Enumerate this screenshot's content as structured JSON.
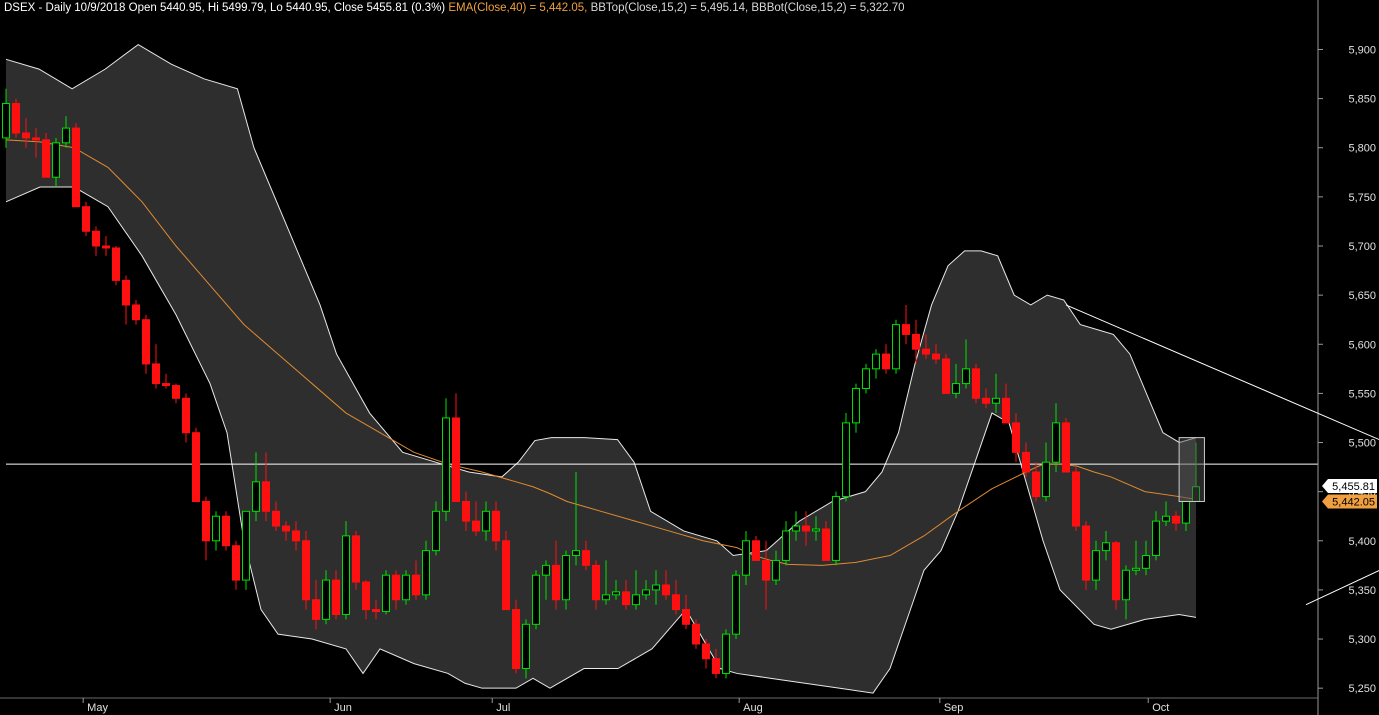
{
  "header": {
    "symbol_line": "DSEX - Daily 10/9/2018 Open 5440.95, Hi 5499.79, Lo 5440.95, Close 5455.81 (0.3%)",
    "ema_label": "EMA(Close,40) = 5,442.05,",
    "bb_label": "BBTop(Close,15,2) = 5,495.14, BBBot(Close,15,2) = 5,322.70"
  },
  "badges": {
    "close": "5,455.81",
    "ema": "5,442.05"
  },
  "colors": {
    "background": "#000000",
    "band_fill": "#2e2e2e",
    "band_line": "#e8e8e8",
    "bull": "#00e000",
    "bear": "#ff1010",
    "ema": "#e08a30",
    "trendline": "#ffffff",
    "close_badge": "#ffffff",
    "ema_badge": "#f0a040"
  },
  "chart_data": {
    "type": "candlestick",
    "title": "DSEX - Daily",
    "ylim": [
      5240,
      5930
    ],
    "y_ticks": [
      5250,
      5300,
      5350,
      5400,
      5450,
      5500,
      5550,
      5600,
      5650,
      5700,
      5750,
      5800,
      5850,
      5900
    ],
    "y_tick_labels": [
      "5,250",
      "5,300",
      "5,350",
      "5,400",
      "5,450",
      "5,500",
      "5,550",
      "5,600",
      "5,650",
      "5,700",
      "5,750",
      "5,800",
      "5,850",
      "5,900"
    ],
    "x_ticks": [
      {
        "label": "May",
        "index": 10
      },
      {
        "label": "Jun",
        "index": 42
      },
      {
        "label": "Jul",
        "index": 63
      },
      {
        "label": "Aug",
        "index": 95
      },
      {
        "label": "Sep",
        "index": 121
      },
      {
        "label": "Oct",
        "index": 148
      }
    ],
    "n_slots": 171,
    "horizontal_line": 5478,
    "candles": [
      [
        5810,
        5860,
        5800,
        5845
      ],
      [
        5845,
        5850,
        5810,
        5815
      ],
      [
        5815,
        5830,
        5800,
        5810
      ],
      [
        5810,
        5820,
        5790,
        5808
      ],
      [
        5808,
        5815,
        5770,
        5770
      ],
      [
        5770,
        5810,
        5760,
        5805
      ],
      [
        5805,
        5832,
        5800,
        5820
      ],
      [
        5820,
        5825,
        5740,
        5740
      ],
      [
        5740,
        5745,
        5710,
        5715
      ],
      [
        5715,
        5720,
        5690,
        5700
      ],
      [
        5700,
        5710,
        5690,
        5698
      ],
      [
        5698,
        5700,
        5660,
        5665
      ],
      [
        5665,
        5670,
        5620,
        5640
      ],
      [
        5640,
        5645,
        5620,
        5625
      ],
      [
        5625,
        5630,
        5570,
        5580
      ],
      [
        5580,
        5600,
        5555,
        5560
      ],
      [
        5560,
        5570,
        5555,
        5558
      ],
      [
        5558,
        5560,
        5540,
        5545
      ],
      [
        5545,
        5550,
        5500,
        5510
      ],
      [
        5510,
        5515,
        5440,
        5440
      ],
      [
        5440,
        5445,
        5380,
        5400
      ],
      [
        5400,
        5430,
        5390,
        5425
      ],
      [
        5425,
        5430,
        5390,
        5395
      ],
      [
        5395,
        5400,
        5350,
        5360
      ],
      [
        5360,
        5430,
        5350,
        5430
      ],
      [
        5430,
        5490,
        5420,
        5460
      ],
      [
        5460,
        5490,
        5420,
        5430
      ],
      [
        5430,
        5440,
        5410,
        5415
      ],
      [
        5415,
        5420,
        5400,
        5410
      ],
      [
        5410,
        5420,
        5390,
        5400
      ],
      [
        5400,
        5410,
        5330,
        5340
      ],
      [
        5340,
        5360,
        5310,
        5320
      ],
      [
        5320,
        5370,
        5315,
        5360
      ],
      [
        5360,
        5370,
        5320,
        5325
      ],
      [
        5325,
        5420,
        5320,
        5405
      ],
      [
        5405,
        5410,
        5350,
        5358
      ],
      [
        5358,
        5360,
        5320,
        5330
      ],
      [
        5330,
        5340,
        5320,
        5328
      ],
      [
        5328,
        5370,
        5325,
        5365
      ],
      [
        5365,
        5370,
        5330,
        5340
      ],
      [
        5340,
        5370,
        5335,
        5365
      ],
      [
        5365,
        5380,
        5340,
        5345
      ],
      [
        5345,
        5400,
        5340,
        5390
      ],
      [
        5390,
        5440,
        5385,
        5430
      ],
      [
        5430,
        5545,
        5420,
        5525
      ],
      [
        5525,
        5550,
        5440,
        5440
      ],
      [
        5440,
        5450,
        5410,
        5420
      ],
      [
        5420,
        5440,
        5405,
        5410
      ],
      [
        5410,
        5440,
        5400,
        5430
      ],
      [
        5430,
        5440,
        5390,
        5400
      ],
      [
        5400,
        5410,
        5330,
        5330
      ],
      [
        5330,
        5340,
        5265,
        5270
      ],
      [
        5270,
        5320,
        5260,
        5315
      ],
      [
        5315,
        5370,
        5310,
        5365
      ],
      [
        5365,
        5380,
        5340,
        5375
      ],
      [
        5375,
        5400,
        5330,
        5340
      ],
      [
        5340,
        5390,
        5330,
        5385
      ],
      [
        5385,
        5470,
        5375,
        5390
      ],
      [
        5390,
        5400,
        5370,
        5375
      ],
      [
        5375,
        5380,
        5330,
        5340
      ],
      [
        5340,
        5380,
        5335,
        5345
      ],
      [
        5345,
        5360,
        5340,
        5348
      ],
      [
        5348,
        5360,
        5330,
        5335
      ],
      [
        5335,
        5370,
        5330,
        5345
      ],
      [
        5345,
        5360,
        5340,
        5350
      ],
      [
        5350,
        5370,
        5335,
        5355
      ],
      [
        5355,
        5370,
        5340,
        5345
      ],
      [
        5345,
        5360,
        5325,
        5330
      ],
      [
        5330,
        5345,
        5310,
        5315
      ],
      [
        5315,
        5320,
        5290,
        5295
      ],
      [
        5295,
        5300,
        5270,
        5280
      ],
      [
        5280,
        5290,
        5260,
        5265
      ],
      [
        5265,
        5310,
        5260,
        5305
      ],
      [
        5305,
        5370,
        5300,
        5365
      ],
      [
        5365,
        5410,
        5355,
        5400
      ],
      [
        5400,
        5405,
        5380,
        5380
      ],
      [
        5380,
        5400,
        5330,
        5360
      ],
      [
        5360,
        5390,
        5355,
        5380
      ],
      [
        5380,
        5420,
        5375,
        5410
      ],
      [
        5410,
        5430,
        5400,
        5415
      ],
      [
        5415,
        5430,
        5395,
        5410
      ],
      [
        5410,
        5425,
        5400,
        5412
      ],
      [
        5412,
        5420,
        5380,
        5380
      ],
      [
        5380,
        5450,
        5375,
        5445
      ],
      [
        5445,
        5530,
        5440,
        5520
      ],
      [
        5520,
        5560,
        5510,
        5555
      ],
      [
        5555,
        5580,
        5550,
        5575
      ],
      [
        5575,
        5595,
        5565,
        5590
      ],
      [
        5590,
        5600,
        5570,
        5575
      ],
      [
        5575,
        5625,
        5570,
        5620
      ],
      [
        5620,
        5640,
        5600,
        5610
      ],
      [
        5610,
        5625,
        5580,
        5595
      ],
      [
        5595,
        5610,
        5585,
        5590
      ],
      [
        5590,
        5600,
        5580,
        5585
      ],
      [
        5585,
        5590,
        5550,
        5550
      ],
      [
        5550,
        5580,
        5545,
        5560
      ],
      [
        5560,
        5605,
        5555,
        5575
      ],
      [
        5575,
        5580,
        5540,
        5545
      ],
      [
        5545,
        5555,
        5535,
        5540
      ],
      [
        5540,
        5570,
        5530,
        5545
      ],
      [
        5545,
        5560,
        5520,
        5520
      ],
      [
        5520,
        5530,
        5480,
        5490
      ],
      [
        5490,
        5500,
        5465,
        5470
      ],
      [
        5470,
        5480,
        5440,
        5445
      ],
      [
        5445,
        5500,
        5440,
        5480
      ],
      [
        5480,
        5540,
        5470,
        5520
      ],
      [
        5520,
        5525,
        5470,
        5470
      ],
      [
        5470,
        5475,
        5410,
        5415
      ],
      [
        5415,
        5420,
        5350,
        5360
      ],
      [
        5360,
        5400,
        5350,
        5390
      ],
      [
        5390,
        5410,
        5380,
        5398
      ],
      [
        5398,
        5400,
        5330,
        5340
      ],
      [
        5340,
        5375,
        5320,
        5370
      ],
      [
        5370,
        5400,
        5365,
        5372
      ],
      [
        5372,
        5400,
        5365,
        5385
      ],
      [
        5385,
        5430,
        5380,
        5420
      ],
      [
        5420,
        5440,
        5415,
        5425
      ],
      [
        5425,
        5430,
        5410,
        5418
      ],
      [
        5418,
        5440,
        5410,
        5440
      ],
      [
        5440,
        5500,
        5440,
        5455
      ]
    ],
    "candle_slots": [
      0,
      1,
      2,
      3,
      4,
      5,
      6,
      7,
      8,
      9,
      10,
      11,
      12,
      13,
      14,
      15,
      16,
      17,
      18,
      19,
      20,
      21,
      22,
      23,
      24,
      25,
      26,
      27,
      28,
      29,
      30,
      31,
      32,
      33,
      34,
      35,
      36,
      37,
      38,
      39,
      40,
      41,
      42,
      43,
      44,
      45,
      46,
      47,
      48,
      49,
      50,
      51,
      52,
      53,
      54,
      55,
      56,
      57,
      58,
      59,
      60,
      61,
      62,
      63,
      64,
      65,
      66,
      67,
      68,
      69,
      70,
      71,
      72,
      73,
      74,
      75,
      76,
      77,
      78,
      79,
      80,
      81,
      82,
      83,
      84,
      85,
      86,
      87,
      88,
      89,
      90,
      91,
      92,
      93,
      94,
      95,
      96,
      97,
      98,
      99,
      100,
      101,
      102,
      103,
      104,
      105,
      106,
      107,
      108,
      109,
      110,
      111,
      112,
      113,
      114,
      115,
      116,
      117,
      118,
      119
    ],
    "bb_top": [
      [
        0,
        5890
      ],
      [
        4,
        5880
      ],
      [
        8,
        5860
      ],
      [
        12,
        5880
      ],
      [
        16,
        5905
      ],
      [
        20,
        5885
      ],
      [
        24,
        5870
      ],
      [
        28,
        5860
      ],
      [
        30,
        5800
      ],
      [
        34,
        5720
      ],
      [
        38,
        5640
      ],
      [
        40,
        5590
      ],
      [
        44,
        5530
      ],
      [
        48,
        5490
      ],
      [
        52,
        5480
      ],
      [
        56,
        5470
      ],
      [
        60,
        5465
      ],
      [
        62,
        5480
      ],
      [
        64,
        5502
      ],
      [
        66,
        5505
      ],
      [
        70,
        5505
      ],
      [
        74,
        5503
      ],
      [
        76,
        5480
      ],
      [
        78,
        5430
      ],
      [
        82,
        5410
      ],
      [
        86,
        5400
      ],
      [
        88,
        5385
      ],
      [
        92,
        5390
      ],
      [
        96,
        5420
      ],
      [
        100,
        5440
      ],
      [
        104,
        5450
      ],
      [
        106,
        5470
      ],
      [
        108,
        5510
      ],
      [
        110,
        5580
      ],
      [
        112,
        5640
      ],
      [
        114,
        5680
      ],
      [
        116,
        5695
      ],
      [
        118,
        5695
      ],
      [
        120,
        5690
      ],
      [
        122,
        5650
      ],
      [
        124,
        5640
      ],
      [
        126,
        5650
      ],
      [
        128,
        5645
      ],
      [
        130,
        5620
      ],
      [
        132,
        5615
      ],
      [
        134,
        5610
      ],
      [
        136,
        5590
      ],
      [
        138,
        5550
      ],
      [
        140,
        5510
      ],
      [
        142,
        5500
      ],
      [
        144,
        5505
      ]
    ],
    "bb_bot": [
      [
        0,
        5745
      ],
      [
        4,
        5760
      ],
      [
        8,
        5760
      ],
      [
        12,
        5740
      ],
      [
        16,
        5690
      ],
      [
        20,
        5630
      ],
      [
        24,
        5560
      ],
      [
        26,
        5510
      ],
      [
        28,
        5400
      ],
      [
        30,
        5330
      ],
      [
        32,
        5305
      ],
      [
        36,
        5300
      ],
      [
        40,
        5290
      ],
      [
        42,
        5265
      ],
      [
        44,
        5290
      ],
      [
        48,
        5275
      ],
      [
        52,
        5265
      ],
      [
        54,
        5255
      ],
      [
        56,
        5250
      ],
      [
        60,
        5250
      ],
      [
        62,
        5260
      ],
      [
        64,
        5250
      ],
      [
        68,
        5270
      ],
      [
        72,
        5270
      ],
      [
        76,
        5290
      ],
      [
        80,
        5330
      ],
      [
        84,
        5270
      ],
      [
        86,
        5265
      ],
      [
        90,
        5260
      ],
      [
        94,
        5255
      ],
      [
        98,
        5250
      ],
      [
        102,
        5245
      ],
      [
        104,
        5270
      ],
      [
        106,
        5320
      ],
      [
        108,
        5370
      ],
      [
        110,
        5390
      ],
      [
        112,
        5430
      ],
      [
        114,
        5480
      ],
      [
        116,
        5530
      ],
      [
        118,
        5520
      ],
      [
        120,
        5460
      ],
      [
        122,
        5400
      ],
      [
        124,
        5350
      ],
      [
        128,
        5315
      ],
      [
        130,
        5310
      ],
      [
        134,
        5320
      ],
      [
        138,
        5325
      ],
      [
        140,
        5322
      ]
    ],
    "ema": [
      [
        0,
        5808
      ],
      [
        4,
        5806
      ],
      [
        8,
        5800
      ],
      [
        12,
        5780
      ],
      [
        16,
        5745
      ],
      [
        20,
        5700
      ],
      [
        24,
        5660
      ],
      [
        28,
        5620
      ],
      [
        32,
        5590
      ],
      [
        36,
        5560
      ],
      [
        40,
        5530
      ],
      [
        44,
        5510
      ],
      [
        48,
        5490
      ],
      [
        52,
        5478
      ],
      [
        56,
        5470
      ],
      [
        60,
        5460
      ],
      [
        62,
        5455
      ],
      [
        64,
        5448
      ],
      [
        66,
        5440
      ],
      [
        70,
        5430
      ],
      [
        74,
        5420
      ],
      [
        78,
        5410
      ],
      [
        82,
        5400
      ],
      [
        86,
        5393
      ],
      [
        88,
        5385
      ],
      [
        90,
        5380
      ],
      [
        92,
        5376
      ],
      [
        96,
        5375
      ],
      [
        100,
        5378
      ],
      [
        104,
        5385
      ],
      [
        108,
        5405
      ],
      [
        112,
        5430
      ],
      [
        116,
        5453
      ],
      [
        120,
        5470
      ],
      [
        122,
        5478
      ],
      [
        124,
        5478
      ],
      [
        126,
        5476
      ],
      [
        128,
        5470
      ],
      [
        130,
        5465
      ],
      [
        134,
        5450
      ],
      [
        138,
        5445
      ],
      [
        140,
        5442
      ]
    ],
    "trendlines": [
      {
        "from": [
          106,
          5640
        ],
        "to": [
          170,
          5360
        ]
      },
      {
        "from": [
          130,
          5335
        ],
        "to": [
          170,
          5525
        ]
      }
    ],
    "highlight_box": {
      "x_from": 139,
      "x_to": 142,
      "y_from": 5440,
      "y_to": 5505
    }
  }
}
